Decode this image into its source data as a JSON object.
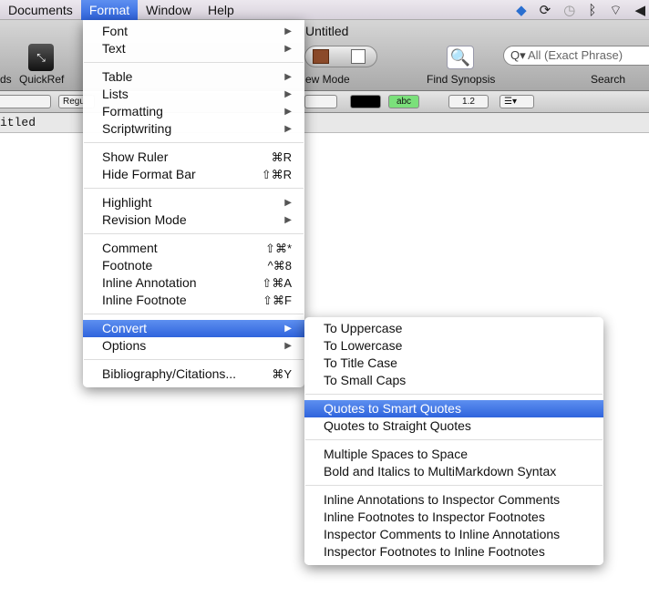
{
  "menubar": {
    "items": [
      "Documents",
      "Format",
      "Window",
      "Help"
    ],
    "active": "Format"
  },
  "window": {
    "title": "Untitled",
    "header_text": "itled"
  },
  "toolbar": {
    "partial_label": "ds",
    "quickref": "QuickRef",
    "view_mode": "ew Mode",
    "find_synopsis": "Find Synopsis",
    "search_label": "Search",
    "search_placeholder": "All (Exact Phrase)"
  },
  "formatbar": {
    "style_partial": "Regu",
    "highlight": "abc",
    "line_spacing": "1.2"
  },
  "format_menu": {
    "groups": [
      [
        {
          "label": "Font",
          "submenu": true
        },
        {
          "label": "Text",
          "submenu": true
        }
      ],
      [
        {
          "label": "Table",
          "submenu": true
        },
        {
          "label": "Lists",
          "submenu": true
        },
        {
          "label": "Formatting",
          "submenu": true
        },
        {
          "label": "Scriptwriting",
          "submenu": true
        }
      ],
      [
        {
          "label": "Show Ruler",
          "shortcut": "⌘R"
        },
        {
          "label": "Hide Format Bar",
          "shortcut": "⇧⌘R"
        }
      ],
      [
        {
          "label": "Highlight",
          "submenu": true
        },
        {
          "label": "Revision Mode",
          "submenu": true
        }
      ],
      [
        {
          "label": "Comment",
          "shortcut": "⇧⌘*"
        },
        {
          "label": "Footnote",
          "shortcut": "^⌘8"
        },
        {
          "label": "Inline Annotation",
          "shortcut": "⇧⌘A"
        },
        {
          "label": "Inline Footnote",
          "shortcut": "⇧⌘F"
        }
      ],
      [
        {
          "label": "Convert",
          "submenu": true,
          "highlighted": true
        },
        {
          "label": "Options",
          "submenu": true
        }
      ],
      [
        {
          "label": "Bibliography/Citations...",
          "shortcut": "⌘Y"
        }
      ]
    ]
  },
  "convert_menu": {
    "groups": [
      [
        {
          "label": "To Uppercase"
        },
        {
          "label": "To Lowercase"
        },
        {
          "label": "To Title Case"
        },
        {
          "label": "To Small Caps"
        }
      ],
      [
        {
          "label": "Quotes to Smart Quotes",
          "highlighted": true
        },
        {
          "label": "Quotes to Straight Quotes"
        }
      ],
      [
        {
          "label": "Multiple Spaces to Space"
        },
        {
          "label": "Bold and Italics to MultiMarkdown Syntax"
        }
      ],
      [
        {
          "label": "Inline Annotations to Inspector Comments"
        },
        {
          "label": "Inline Footnotes to Inspector Footnotes"
        },
        {
          "label": "Inspector Comments to Inline Annotations"
        },
        {
          "label": "Inspector Footnotes to Inline Footnotes"
        }
      ]
    ]
  }
}
